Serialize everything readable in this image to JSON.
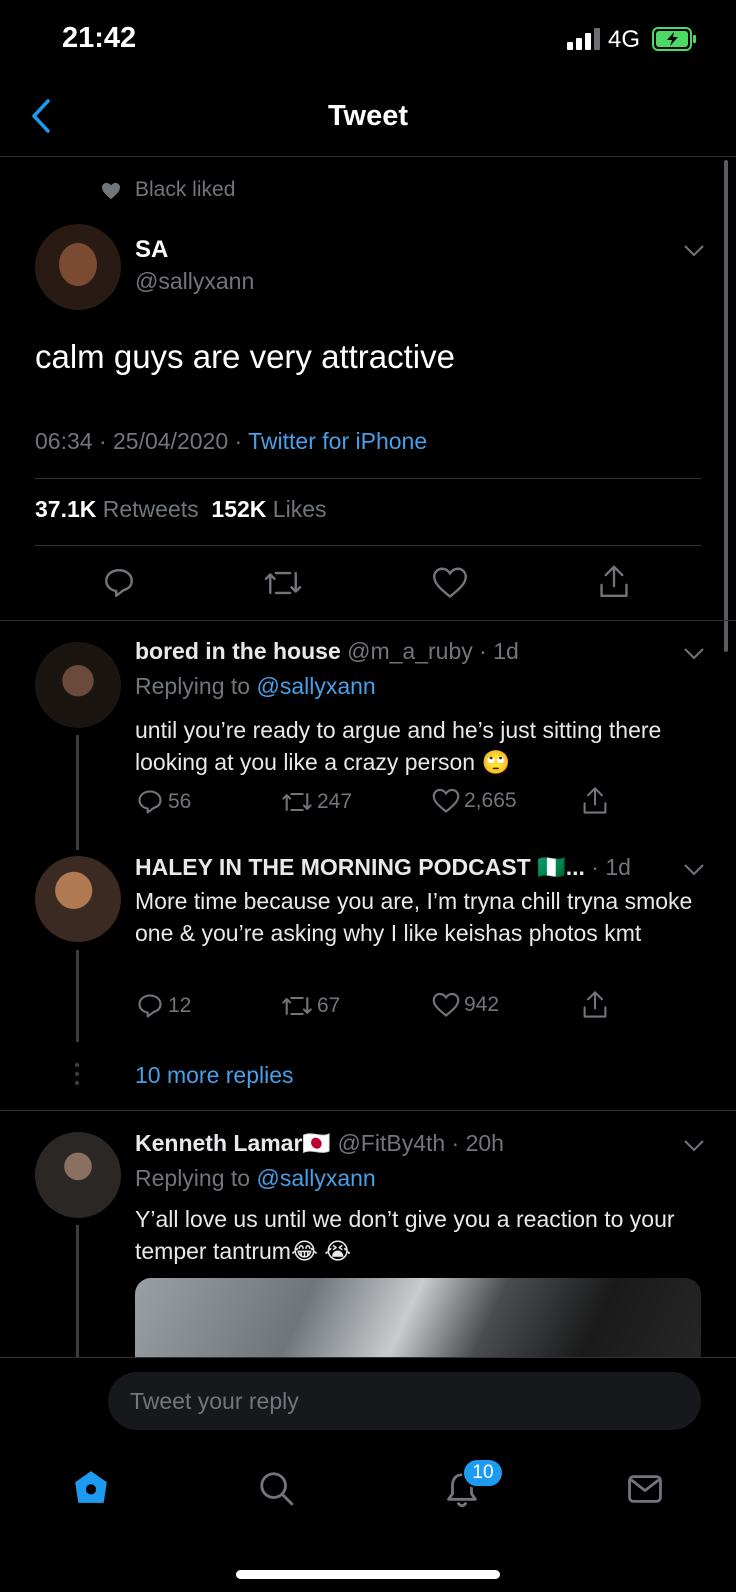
{
  "status_bar": {
    "time": "21:42",
    "network": "4G"
  },
  "header": {
    "title": "Tweet"
  },
  "main_tweet": {
    "social_context": "Black liked",
    "name": "SA",
    "handle": "@sallyxann",
    "text": "calm guys are very attractive",
    "timestamp": "06:34 · 25/04/2020 · ",
    "source": "Twitter for iPhone",
    "retweets_count": "37.1K",
    "retweets_label": "Retweets",
    "likes_count": "152K",
    "likes_label": "Likes"
  },
  "replies": [
    {
      "name": "bored in the house",
      "handle": "@m_a_ruby · 1d",
      "replying_prefix": "Replying to ",
      "replying_to": "@sallyxann",
      "text": "until you’re ready to argue and he’s just sitting there looking at you like a crazy person 🙄",
      "replies": "56",
      "retweets": "247",
      "likes": "2,665"
    },
    {
      "name": "HALEY IN THE MORNING PODCAST 🇳🇬...",
      "handle": "· 1d",
      "text": "More time because you are, I’m tryna chill tryna smoke one & you’re asking why I like keishas photos kmt",
      "replies": "12",
      "retweets": "67",
      "likes": "942"
    },
    {
      "name": "Kenneth Lamar🇯🇵",
      "handle": "@FitBy4th · 20h",
      "replying_prefix": "Replying to ",
      "replying_to": "@sallyxann",
      "text": "Y’all love us until we don’t give you a  reaction to your temper tantrum😂 😭"
    }
  ],
  "more_replies": "10 more replies",
  "compose": {
    "placeholder": "Tweet your reply"
  },
  "tab_bar": {
    "notifications_badge": "10"
  },
  "colors": {
    "accent": "#1d9bf0",
    "link": "#4a9fe8",
    "battery": "#4cd964"
  }
}
